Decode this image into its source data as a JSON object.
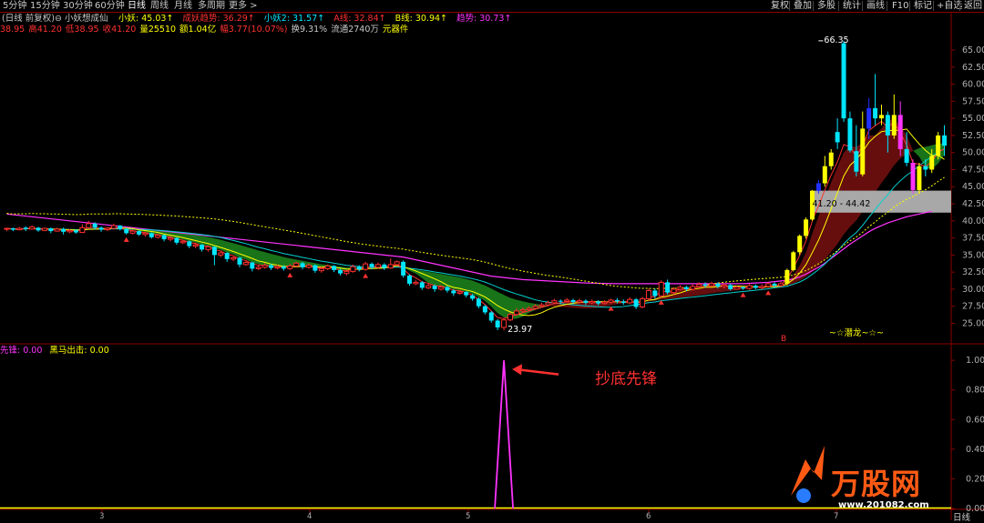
{
  "toolbar": {
    "timeframes": [
      "5分钟",
      "15分钟",
      "30分钟",
      "60分钟",
      "日线",
      "周线",
      "月线",
      "多周期",
      "更多 >"
    ],
    "active_index": 4,
    "right_buttons": [
      "复权",
      "叠加",
      "多股",
      "统计",
      "画线",
      "F10",
      "标记",
      "+自选",
      "返回"
    ]
  },
  "legend": {
    "label": "(日线 前复权)",
    "indicator": "小妖想成仙",
    "items": [
      {
        "text": "小妖: 45.03↑",
        "color": "#ffff00"
      },
      {
        "text": "成妖趋势: 36.29↑",
        "color": "#ff3030"
      },
      {
        "text": "小妖2: 31.57↑",
        "color": "#00e5ff"
      },
      {
        "text": "A线: 32.84↑",
        "color": "#ff3030"
      },
      {
        "text": "B线: 30.94↑",
        "color": "#ffff00"
      },
      {
        "text": "趋势: 30.73↑",
        "color": "#ff33ff"
      }
    ]
  },
  "quote": {
    "items": [
      {
        "text": "38.95",
        "color": "#ff3030"
      },
      {
        "text": "高41.20",
        "color": "#ff3030"
      },
      {
        "text": "低38.95",
        "color": "#ff3030"
      },
      {
        "text": "收41.20",
        "color": "#ff3030"
      },
      {
        "text": "量25510",
        "color": "#ffff00"
      },
      {
        "text": "额1.04亿",
        "color": "#ffff00"
      },
      {
        "text": "幅3.77(10.07%)",
        "color": "#ff3030"
      },
      {
        "text": "换9.31%",
        "color": "#c8c8c8"
      },
      {
        "text": "流通2740万",
        "color": "#c8c8c8"
      },
      {
        "text": "元器件",
        "color": "#ffff00"
      }
    ]
  },
  "sub_legend": {
    "items": [
      {
        "text": "先锋: 0.00",
        "color": "#ff33ff"
      },
      {
        "text": "黑马出击: 0.00",
        "color": "#ffff00"
      }
    ]
  },
  "annotations": {
    "max_label": "66.35",
    "min_label": "23.97",
    "box_label": "41.20 - 44.42",
    "dragon": "~☆潜龙~☆~",
    "buy_marker": "B",
    "arrow_label": "抄底先锋",
    "bottom_tab": "日线"
  },
  "watermark": {
    "title": "万股网",
    "url": "www.201082.com"
  },
  "colors": {
    "up": "#ff3030",
    "down": "#00e5ff",
    "yellow": "#ffff00",
    "magenta": "#ff33ff",
    "green_fill": "#1a7a1a",
    "red_fill": "#6b0f0f",
    "axis": "#8b0000",
    "gray_box": "#a8a8a8"
  },
  "chart_data": [
    {
      "type": "candlestick",
      "title": "",
      "y_axis": {
        "min": 22,
        "max": 67,
        "ticks": [
          65.0,
          62.5,
          60.0,
          57.5,
          55.0,
          52.5,
          50.0,
          47.5,
          45.0,
          42.5,
          40.0,
          37.5,
          35.0,
          32.5,
          30.0,
          27.5,
          25.0
        ]
      },
      "x_ticks": [
        "3",
        "4",
        "5",
        "6",
        "7"
      ],
      "candles": [
        [
          38.8,
          38.9,
          38.5,
          39.0
        ],
        [
          38.9,
          38.7,
          38.5,
          39.0
        ],
        [
          38.7,
          38.9,
          38.6,
          39.1
        ],
        [
          39.0,
          38.8,
          38.5,
          39.2
        ],
        [
          38.8,
          39.1,
          38.7,
          39.3
        ],
        [
          39.0,
          38.6,
          38.4,
          39.1
        ],
        [
          38.6,
          38.9,
          38.5,
          39.0
        ],
        [
          38.9,
          38.5,
          38.2,
          39.0
        ],
        [
          38.5,
          38.8,
          38.4,
          39.0
        ],
        [
          38.8,
          38.4,
          38.0,
          39.0
        ],
        [
          38.4,
          38.6,
          38.2,
          38.8
        ],
        [
          38.6,
          38.3,
          38.1,
          38.7
        ],
        [
          38.3,
          39.0,
          38.2,
          39.5
        ],
        [
          39.0,
          39.6,
          38.8,
          40.0
        ],
        [
          39.6,
          39.0,
          38.7,
          39.8
        ],
        [
          39.0,
          38.7,
          38.4,
          39.2
        ],
        [
          38.7,
          38.9,
          38.5,
          39.1
        ],
        [
          38.9,
          39.3,
          38.7,
          39.6
        ],
        [
          39.3,
          38.8,
          38.6,
          39.4
        ],
        [
          38.8,
          38.2,
          38.0,
          39.0
        ],
        [
          38.2,
          38.5,
          38.0,
          38.7
        ],
        [
          38.5,
          38.0,
          37.8,
          38.6
        ],
        [
          38.0,
          38.2,
          37.7,
          38.4
        ],
        [
          38.2,
          37.6,
          37.4,
          38.3
        ],
        [
          37.6,
          37.9,
          37.4,
          38.1
        ],
        [
          37.9,
          37.3,
          37.0,
          38.0
        ],
        [
          37.3,
          37.5,
          37.0,
          37.8
        ],
        [
          37.5,
          36.8,
          36.5,
          37.6
        ],
        [
          36.8,
          37.0,
          36.6,
          37.2
        ],
        [
          37.0,
          36.3,
          36.0,
          37.1
        ],
        [
          36.3,
          36.5,
          36.0,
          36.8
        ],
        [
          36.5,
          35.8,
          35.5,
          36.6
        ],
        [
          35.8,
          36.2,
          35.5,
          36.4
        ],
        [
          36.2,
          35.0,
          33.5,
          36.3
        ],
        [
          35.0,
          35.3,
          34.7,
          35.5
        ],
        [
          35.3,
          34.4,
          34.0,
          35.4
        ],
        [
          34.4,
          34.6,
          34.1,
          34.8
        ],
        [
          34.6,
          33.6,
          33.2,
          34.7
        ],
        [
          33.6,
          33.9,
          33.4,
          34.1
        ],
        [
          33.9,
          33.0,
          32.6,
          34.0
        ],
        [
          33.0,
          33.2,
          32.8,
          33.5
        ],
        [
          33.2,
          33.5,
          33.0,
          33.8
        ],
        [
          33.5,
          33.1,
          32.8,
          33.7
        ],
        [
          33.1,
          33.3,
          32.9,
          33.6
        ],
        [
          33.3,
          33.0,
          32.7,
          33.5
        ],
        [
          33.0,
          33.4,
          32.8,
          33.7
        ],
        [
          33.4,
          33.8,
          33.2,
          34.0
        ],
        [
          33.8,
          33.2,
          32.9,
          34.0
        ],
        [
          33.2,
          33.5,
          33.0,
          33.8
        ],
        [
          33.5,
          32.7,
          32.4,
          33.6
        ],
        [
          32.7,
          33.0,
          32.4,
          33.3
        ],
        [
          33.0,
          33.4,
          32.8,
          33.6
        ],
        [
          33.4,
          32.8,
          32.5,
          33.5
        ],
        [
          32.8,
          32.3,
          32.0,
          33.0
        ],
        [
          32.3,
          32.6,
          32.0,
          32.8
        ],
        [
          32.6,
          33.3,
          32.4,
          33.6
        ],
        [
          33.3,
          32.9,
          32.6,
          33.5
        ],
        [
          32.9,
          33.7,
          32.7,
          34.0
        ],
        [
          33.7,
          33.2,
          32.9,
          33.9
        ],
        [
          33.2,
          33.6,
          33.0,
          33.9
        ],
        [
          33.6,
          33.1,
          32.8,
          33.8
        ],
        [
          33.1,
          33.6,
          33.0,
          34.5
        ],
        [
          33.6,
          34.0,
          33.4,
          34.2
        ],
        [
          34.0,
          32.0,
          31.7,
          34.2
        ],
        [
          32.0,
          30.8,
          30.5,
          32.2
        ],
        [
          30.8,
          31.0,
          30.6,
          31.3
        ],
        [
          31.0,
          30.2,
          29.9,
          31.2
        ],
        [
          30.2,
          30.5,
          30.0,
          30.8
        ],
        [
          30.5,
          30.0,
          29.6,
          30.7
        ],
        [
          30.0,
          30.3,
          29.8,
          30.6
        ],
        [
          30.3,
          29.8,
          29.5,
          30.5
        ],
        [
          29.8,
          29.4,
          29.0,
          30.0
        ],
        [
          29.4,
          29.6,
          29.2,
          29.8
        ],
        [
          29.6,
          29.1,
          28.8,
          29.7
        ],
        [
          29.1,
          28.6,
          28.3,
          29.3
        ],
        [
          28.6,
          27.5,
          27.2,
          28.8
        ],
        [
          27.5,
          26.6,
          26.3,
          27.7
        ],
        [
          26.6,
          25.4,
          25.1,
          26.8
        ],
        [
          25.4,
          24.4,
          24.0,
          25.6
        ],
        [
          24.4,
          25.5,
          23.97,
          25.7
        ],
        [
          25.5,
          26.3,
          25.3,
          26.6
        ],
        [
          26.3,
          26.8,
          26.1,
          27.2
        ],
        [
          26.8,
          27.0,
          26.6,
          27.3
        ],
        [
          27.0,
          27.2,
          26.8,
          27.5
        ],
        [
          27.2,
          27.5,
          27.0,
          27.8
        ],
        [
          27.5,
          27.7,
          27.3,
          28.0
        ],
        [
          27.7,
          28.0,
          27.5,
          28.3
        ],
        [
          28.0,
          28.3,
          27.8,
          28.6
        ],
        [
          28.3,
          28.2,
          27.9,
          28.5
        ],
        [
          28.2,
          28.4,
          28.0,
          28.7
        ],
        [
          28.4,
          28.1,
          27.8,
          28.6
        ],
        [
          28.1,
          28.3,
          27.9,
          28.6
        ],
        [
          28.3,
          28.0,
          27.7,
          28.5
        ],
        [
          28.0,
          28.2,
          27.8,
          28.5
        ],
        [
          28.2,
          27.9,
          27.6,
          28.4
        ],
        [
          27.9,
          28.1,
          27.7,
          28.4
        ],
        [
          28.1,
          28.4,
          27.9,
          28.6
        ],
        [
          28.4,
          28.2,
          27.9,
          28.7
        ],
        [
          28.2,
          28.0,
          27.7,
          28.5
        ],
        [
          28.0,
          28.5,
          27.8,
          28.8
        ],
        [
          28.5,
          27.4,
          27.1,
          28.7
        ],
        [
          27.4,
          28.6,
          27.2,
          28.9
        ],
        [
          28.6,
          29.8,
          28.3,
          30.1
        ],
        [
          29.8,
          29.0,
          28.6,
          30.1
        ],
        [
          29.0,
          31.0,
          28.8,
          31.3
        ],
        [
          31.0,
          29.5,
          29.2,
          31.4
        ],
        [
          29.5,
          30.0,
          29.2,
          30.3
        ],
        [
          30.0,
          30.3,
          29.8,
          30.6
        ],
        [
          30.3,
          30.0,
          29.7,
          30.5
        ],
        [
          30.0,
          30.4,
          29.8,
          30.7
        ],
        [
          30.4,
          30.7,
          30.2,
          31.0
        ],
        [
          30.7,
          30.5,
          30.2,
          31.0
        ],
        [
          30.5,
          30.8,
          30.3,
          31.1
        ],
        [
          30.8,
          30.4,
          30.1,
          31.0
        ],
        [
          30.4,
          30.6,
          30.1,
          30.9
        ],
        [
          30.6,
          30.0,
          29.8,
          30.8
        ],
        [
          30.0,
          30.3,
          29.9,
          30.5
        ],
        [
          30.3,
          30.1,
          29.9,
          30.4
        ],
        [
          30.1,
          30.5,
          29.9,
          30.8
        ],
        [
          30.5,
          30.2,
          30.0,
          30.7
        ],
        [
          30.2,
          30.4,
          30.0,
          30.7
        ],
        [
          30.4,
          30.8,
          30.2,
          31.0
        ],
        [
          30.8,
          30.5,
          30.2,
          31.0
        ],
        [
          30.5,
          30.8,
          30.3,
          31.1
        ],
        [
          30.8,
          32.8,
          30.6,
          33.0
        ],
        [
          32.8,
          35.4,
          32.6,
          35.6
        ],
        [
          35.4,
          37.8,
          35.0,
          38.0
        ],
        [
          37.8,
          40.2,
          37.4,
          40.5
        ],
        [
          40.2,
          44.4,
          40.0,
          44.5
        ],
        [
          44.4,
          45.5,
          44.0,
          46.0
        ],
        [
          45.5,
          48.0,
          45.0,
          49.5
        ],
        [
          48.0,
          50.0,
          47.5,
          50.5
        ],
        [
          53.0,
          51.5,
          50.5,
          55.0
        ],
        [
          66.0,
          55.0,
          54.5,
          66.35
        ],
        [
          55.0,
          50.3,
          50.0,
          56.0
        ],
        [
          50.2,
          47.2,
          46.5,
          54.0
        ],
        [
          46.8,
          53.5,
          46.5,
          56.0
        ],
        [
          53.5,
          56.5,
          52.0,
          58.0
        ],
        [
          56.5,
          55.0,
          54.0,
          61.5
        ],
        [
          55.0,
          55.5,
          54.0,
          57.0
        ],
        [
          55.5,
          52.5,
          50.0,
          56.0
        ],
        [
          52.5,
          55.5,
          52.0,
          58.5
        ],
        [
          55.5,
          50.5,
          49.5,
          57.5
        ],
        [
          50.5,
          48.5,
          48.0,
          53.0
        ],
        [
          48.5,
          44.5,
          44.0,
          49.0
        ],
        [
          44.5,
          48.0,
          44.0,
          48.5
        ],
        [
          48.0,
          47.5,
          46.5,
          49.0
        ],
        [
          47.5,
          49.5,
          47.0,
          50.5
        ],
        [
          49.5,
          52.5,
          49.0,
          53.0
        ],
        [
          52.5,
          51.0,
          49.5,
          54.0
        ]
      ],
      "lines": [
        {
          "name": "小妖",
          "color": "#ff33ff",
          "values": [
            41.0,
            40.9,
            40.8,
            40.7,
            40.6,
            40.5,
            40.4,
            40.3,
            40.2,
            40.1,
            40.0,
            39.9,
            39.8,
            39.7,
            39.6,
            39.5,
            39.4,
            39.3,
            39.2,
            39.1,
            39.0,
            38.9,
            38.8,
            38.7,
            38.6,
            38.5,
            38.4,
            38.3,
            38.2,
            38.1,
            38.0,
            37.9,
            37.8,
            37.7,
            37.6,
            37.5,
            37.4,
            37.3,
            37.2,
            37.1,
            37.0,
            36.9,
            36.8,
            36.7,
            36.6,
            36.5,
            36.4,
            36.3,
            36.2,
            36.1,
            36.0,
            35.9,
            35.8,
            35.7,
            35.6,
            35.5,
            35.4,
            35.3,
            35.2,
            35.1,
            35.0,
            34.9,
            34.8,
            34.7,
            34.5,
            34.3,
            34.1,
            33.9,
            33.7,
            33.5,
            33.3,
            33.1,
            32.9,
            32.7,
            32.5,
            32.3,
            32.1,
            31.9,
            31.8,
            31.7,
            31.6,
            31.5,
            31.4,
            31.35,
            31.3,
            31.25,
            31.2,
            31.15,
            31.1,
            31.05,
            31.0,
            30.95,
            30.9,
            30.88,
            30.86,
            30.84,
            30.82,
            30.8,
            30.8,
            30.8,
            30.8,
            30.8,
            30.8,
            30.8,
            30.8,
            30.8,
            30.8,
            30.8,
            30.8,
            30.8,
            30.8,
            30.8,
            30.8,
            30.8,
            30.8,
            30.8,
            30.8,
            30.8,
            30.85,
            30.9,
            30.95,
            31.0,
            31.1,
            31.2,
            31.3,
            31.5,
            31.8,
            32.2,
            32.7,
            33.2,
            33.8,
            34.5,
            35.2,
            35.9,
            36.6,
            37.2,
            37.8,
            38.4,
            38.9,
            39.3,
            39.7,
            40.0,
            40.3,
            40.6,
            40.8,
            41.0,
            41.2,
            41.4
          ]
        }
      ]
    },
    {
      "type": "line",
      "title": "",
      "y_axis": {
        "min": 0,
        "max": 1.05,
        "ticks": [
          1.0,
          0.8,
          0.6,
          0.4,
          0.2,
          0.0
        ]
      },
      "series": [
        {
          "name": "先锋",
          "color": "#ff33ff",
          "spike_index": 79,
          "spike_value": 1.0
        },
        {
          "name": "黑马出击",
          "color": "#ffff00",
          "value": 0.0
        }
      ]
    }
  ]
}
